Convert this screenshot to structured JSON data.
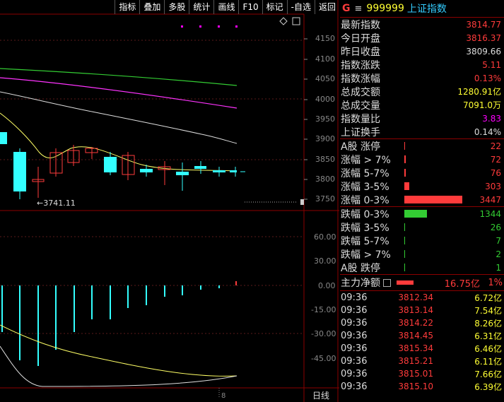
{
  "toolbar": [
    "指标",
    "叠加",
    "多股",
    "统计",
    "画线",
    "F10",
    "标记",
    "-自选",
    "返回"
  ],
  "chart": {
    "yAxis": [
      "4150",
      "4100",
      "4050",
      "4000",
      "3950",
      "3900",
      "3850",
      "3800",
      "3750"
    ],
    "low_label": "←3741.11",
    "sub_axis": [
      "60.00",
      "30.00",
      "0.00",
      "-15.00",
      "-30.00",
      "-45.00"
    ],
    "daily_label": "日线",
    "date_tick": "8"
  },
  "header": {
    "g": "G",
    "menu": "≡",
    "code": "999999",
    "name": "上证指数"
  },
  "quote": [
    {
      "label": "最新指数",
      "value": "3814.77",
      "color": "red"
    },
    {
      "label": "今日开盘",
      "value": "3816.37",
      "color": "red"
    },
    {
      "label": "昨日收盘",
      "value": "3809.66",
      "color": "wht"
    },
    {
      "label": "指数涨跌",
      "value": "5.11",
      "color": "red"
    },
    {
      "label": "指数涨幅",
      "value": "0.13%",
      "color": "red"
    },
    {
      "label": "总成交额",
      "value": "1280.91亿",
      "color": "yel"
    },
    {
      "label": "总成交量",
      "value": "7091.0万",
      "color": "yel"
    },
    {
      "label": "指数量比",
      "value": "3.83",
      "color": "mag"
    },
    {
      "label": "上证换手",
      "value": "0.14%",
      "color": "wht"
    }
  ],
  "up": [
    {
      "label": "A股 涨停",
      "value": "22",
      "count": 22
    },
    {
      "label": "涨幅 > 7%",
      "value": "72",
      "count": 72
    },
    {
      "label": "涨幅 5-7%",
      "value": "76",
      "count": 76
    },
    {
      "label": "涨幅 3-5%",
      "value": "303",
      "count": 303
    },
    {
      "label": "涨幅 0-3%",
      "value": "3447",
      "count": 3447
    }
  ],
  "down": [
    {
      "label": "跌幅 0-3%",
      "value": "1344",
      "count": 1344
    },
    {
      "label": "跌幅 3-5%",
      "value": "26",
      "count": 26
    },
    {
      "label": "跌幅 5-7%",
      "value": "7",
      "count": 7
    },
    {
      "label": "跌幅 > 7%",
      "value": "2",
      "count": 2
    },
    {
      "label": "A股 跌停",
      "value": "1",
      "count": 1
    }
  ],
  "fund": {
    "label": "主力净额",
    "value": "16.75亿",
    "pct": "1%"
  },
  "ticks": [
    {
      "time": "09:36",
      "price": "3812.34",
      "vol": "6.72亿"
    },
    {
      "time": "09:36",
      "price": "3813.14",
      "vol": "7.54亿"
    },
    {
      "time": "09:36",
      "price": "3814.22",
      "vol": "8.26亿"
    },
    {
      "time": "09:36",
      "price": "3814.45",
      "vol": "6.31亿"
    },
    {
      "time": "09:36",
      "price": "3815.34",
      "vol": "6.46亿"
    },
    {
      "time": "09:36",
      "price": "3815.21",
      "vol": "6.11亿"
    },
    {
      "time": "09:36",
      "price": "3815.01",
      "vol": "7.66亿"
    },
    {
      "time": "09:36",
      "price": "3815.10",
      "vol": "6.39亿"
    }
  ]
}
